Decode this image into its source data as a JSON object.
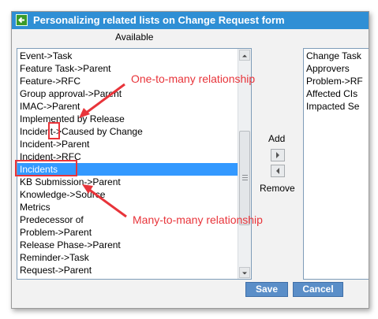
{
  "window": {
    "title": "Personalizing related lists on Change Request form"
  },
  "available": {
    "label": "Available",
    "items": [
      "Event->Task",
      "Feature Task->Parent",
      "Feature->RFC",
      "Group approval->Parent",
      "IMAC->Parent",
      "Implemented by Release",
      "Incident->Caused by Change",
      "Incident->Parent",
      "Incident->RFC",
      "Incidents",
      "KB Submission->Parent",
      "Knowledge->Source",
      "Metrics",
      "Predecessor of",
      "Problem->Parent",
      "Release Phase->Parent",
      "Reminder->Task",
      "Request->Parent"
    ],
    "selected_item": "Incidents"
  },
  "selected": {
    "items": [
      "Change Task",
      "Approvers",
      "Problem->RF",
      "Affected CIs",
      "Impacted Se"
    ]
  },
  "controls": {
    "add_label": "Add",
    "remove_label": "Remove"
  },
  "buttons": {
    "save": "Save",
    "cancel": "Cancel"
  },
  "annotations": {
    "one_to_many": "One-to-many relationship",
    "many_to_many": "Many-to-many relationship"
  },
  "colors": {
    "titlebar": "#2f8fd5",
    "selection": "#3399ff",
    "annotation": "#e8343a",
    "button": "#5a8ec8"
  }
}
